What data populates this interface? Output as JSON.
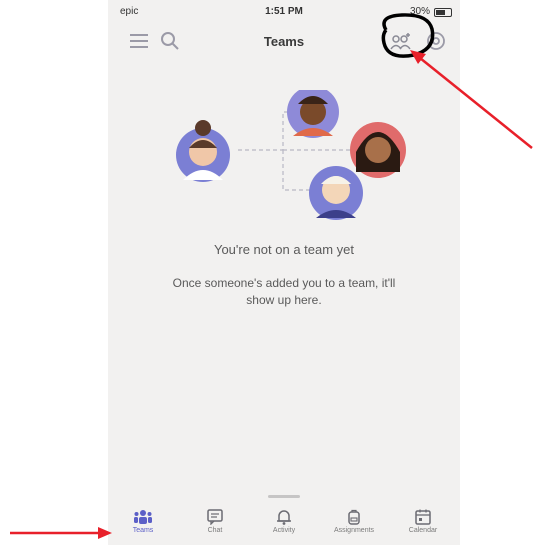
{
  "status": {
    "carrier": "epic",
    "time": "1:51 PM",
    "battery": "30%"
  },
  "header": {
    "title": "Teams"
  },
  "empty_state": {
    "title": "You're not on a team yet",
    "subtitle": "Once someone's added you to a team, it'll show up here."
  },
  "tabs": [
    {
      "label": "Teams",
      "icon": "teams-icon",
      "active": true
    },
    {
      "label": "Chat",
      "icon": "chat-icon",
      "active": false
    },
    {
      "label": "Activity",
      "icon": "bell-icon",
      "active": false
    },
    {
      "label": "Assignments",
      "icon": "backpack-icon",
      "active": false
    },
    {
      "label": "Calendar",
      "icon": "calendar-icon",
      "active": false
    }
  ],
  "colors": {
    "accent": "#5b5fc7",
    "background": "#f2f1f0",
    "annotation_red": "#e8202a",
    "annotation_black": "#000000"
  }
}
